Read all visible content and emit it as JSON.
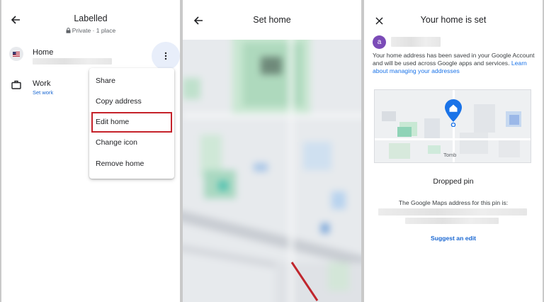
{
  "left_panel": {
    "title": "Labelled",
    "subtitle": "Private · 1 place",
    "home_label": "Home",
    "work_label": "Work",
    "work_sub": "Set work",
    "menu_items": [
      "Share",
      "Copy address",
      "Edit home",
      "Change icon",
      "Remove home"
    ],
    "highlighted_item": "Edit home",
    "highlight_color": "#c5222a"
  },
  "middle_panel": {
    "title": "Set home"
  },
  "right_panel": {
    "title": "Your home is set",
    "avatar_letter": "a",
    "message": "Your home address has been saved in your Google Account and will be used across Google apps and services. ",
    "link": "Learn about managing your addresses",
    "map_label": "Tomb",
    "dropped_pin": "Dropped pin",
    "address_heading": "The Google Maps address for this pin is:",
    "suggest_edit": "Suggest an edit"
  },
  "colors": {
    "accent": "#1a73e8",
    "link_dark": "#1967d2",
    "avatar": "#7b4bb7",
    "arrow": "#c0262d"
  },
  "icons": {
    "back": "arrow-left-icon",
    "lock": "lock-icon",
    "flag": "flag-icon",
    "briefcase": "briefcase-icon",
    "more": "more-vert-icon",
    "close": "close-icon",
    "home_pin": "home-pin-icon"
  }
}
